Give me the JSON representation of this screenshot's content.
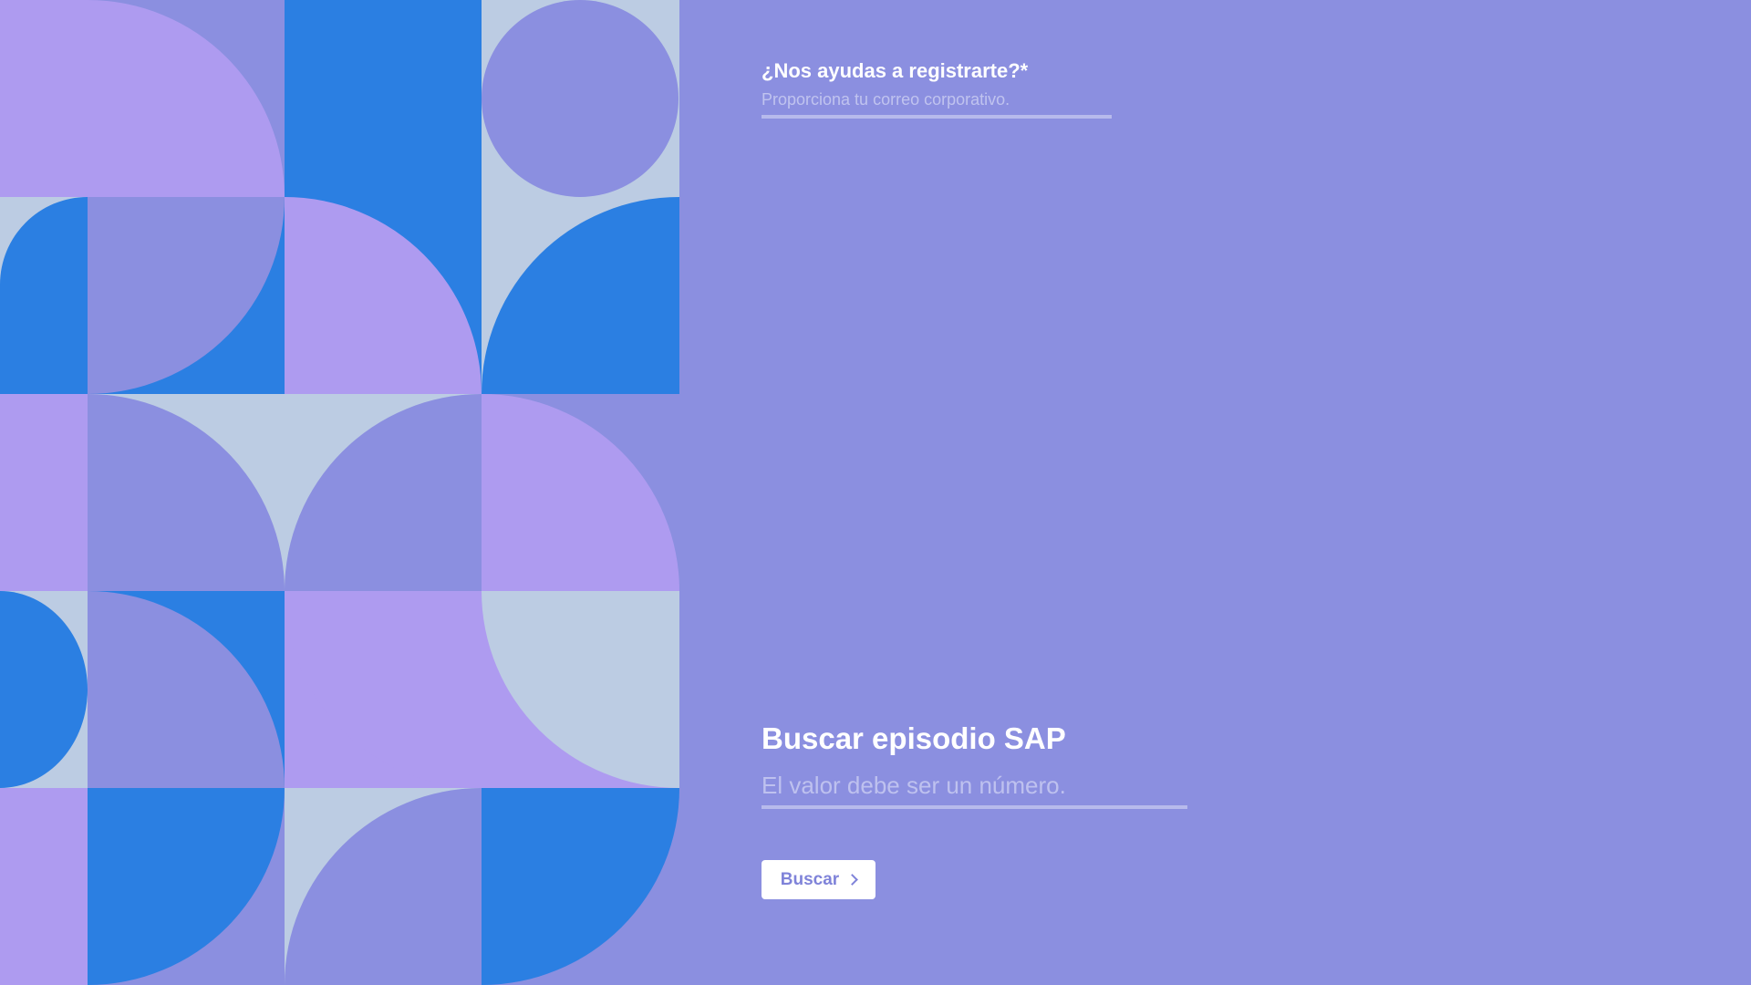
{
  "registration": {
    "label": "¿Nos ayudas a registrarte?*",
    "email_placeholder": "Proporciona tu correo corporativo.",
    "email_value": ""
  },
  "episode_search": {
    "title": "Buscar episodio SAP",
    "placeholder": "El valor debe ser un número.",
    "value": "",
    "button_label": "Buscar",
    "button_icon": "chevron-right-icon"
  },
  "colors": {
    "background": "#8b8fe0",
    "lavender": "#ae9bf0",
    "blue": "#2b7fe2",
    "pale": "#bccce3",
    "periwinkle": "#8b8fe0",
    "button_text": "#7f83d9"
  }
}
